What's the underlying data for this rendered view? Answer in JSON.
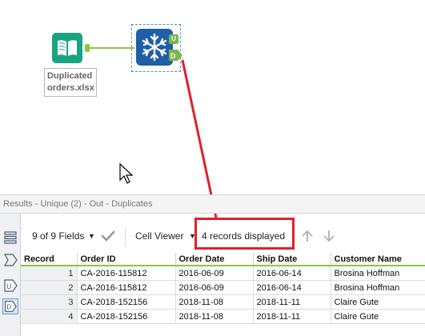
{
  "canvas": {
    "input_label_line1": "Duplicated",
    "input_label_line2": "orders.xlsx",
    "unique_anchor_u": "U",
    "unique_anchor_d": "D"
  },
  "results": {
    "header_title": "Results - Unique (2) - Out - Duplicates",
    "fields_label": "9 of 9 Fields",
    "viewer_label": "Cell Viewer",
    "records_displayed": "4 records displayed",
    "side_buttons": [
      "table-view",
      "out-anchor",
      "U",
      "D"
    ]
  },
  "table": {
    "columns": [
      "Record",
      "Order ID",
      "Order Date",
      "Ship Date",
      "Customer Name"
    ],
    "rows": [
      {
        "record": "1",
        "order_id": "CA-2016-115812",
        "order_date": "2016-06-09",
        "ship_date": "2016-06-14",
        "customer": "Brosina Hoffman"
      },
      {
        "record": "2",
        "order_id": "CA-2016-115812",
        "order_date": "2016-06-09",
        "ship_date": "2016-06-14",
        "customer": "Brosina Hoffman"
      },
      {
        "record": "3",
        "order_id": "CA-2018-152156",
        "order_date": "2018-11-08",
        "ship_date": "2018-11-11",
        "customer": "Claire Gute"
      },
      {
        "record": "4",
        "order_id": "CA-2018-152156",
        "order_date": "2018-11-08",
        "ship_date": "2018-11-11",
        "customer": "Claire Gute"
      }
    ]
  },
  "colors": {
    "accent_green": "#8dc63f",
    "tool_blue": "#1f5fa8",
    "input_teal": "#1aa382",
    "highlight_red": "#e0202c"
  },
  "icons": [
    "book-icon",
    "snowflake-icon",
    "checkmark-icon",
    "arrow-up-icon",
    "arrow-down-icon",
    "dropdown-icon",
    "cursor-icon"
  ]
}
